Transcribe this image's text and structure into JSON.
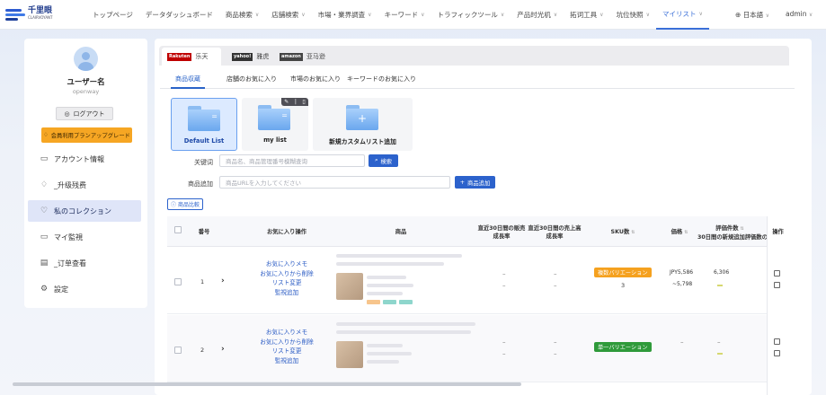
{
  "brand": {
    "name": "千里眼",
    "sub": "CLAIRVOYANT"
  },
  "nav": [
    {
      "label": "トップページ",
      "dropdown": false
    },
    {
      "label": "データダッシュボード",
      "dropdown": false
    },
    {
      "label": "商品検索",
      "dropdown": true
    },
    {
      "label": "店舗検索",
      "dropdown": true
    },
    {
      "label": "市場・業界調査",
      "dropdown": true
    },
    {
      "label": "キーワード",
      "dropdown": true
    },
    {
      "label": "トラフィックツール",
      "dropdown": true
    },
    {
      "label": "产品时光机",
      "dropdown": true
    },
    {
      "label": "拓词工具",
      "dropdown": true
    },
    {
      "label": "坑位快照",
      "dropdown": true
    },
    {
      "label": "マイリスト",
      "dropdown": true,
      "active": true
    }
  ],
  "language": "日本語",
  "user_menu": "admin",
  "profile": {
    "name": "ユーザー名",
    "id": "openway",
    "logout": "ログアウト",
    "upgrade": "会員利用プランアップグレード"
  },
  "side_menu": [
    {
      "label": "アカウント情報",
      "icon": "id-card-icon"
    },
    {
      "label": "_升级残费",
      "icon": "diamond-icon"
    },
    {
      "label": "私のコレクション",
      "icon": "heart-icon",
      "active": true
    },
    {
      "label": "マイ監視",
      "icon": "monitor-icon"
    },
    {
      "label": "_订单查看",
      "icon": "order-icon"
    },
    {
      "label": "設定",
      "icon": "gear-icon"
    }
  ],
  "platforms": [
    {
      "logo": "Rakuten",
      "label": "乐天",
      "active": true
    },
    {
      "logo": "yahoo!",
      "label": "雅虎"
    },
    {
      "logo": "amazon",
      "label": "亚马逊"
    }
  ],
  "subtabs": [
    "商品収蔵",
    "店舗のお気に入り",
    "市場のお気に入り",
    "キーワードのお気に入り"
  ],
  "lists": [
    {
      "label": "Default List",
      "active": true
    },
    {
      "label": "my list"
    },
    {
      "label": "新規カスタムリスト追加",
      "add": true
    }
  ],
  "keyword": {
    "label": "关键词",
    "placeholder": "商品名、商品管理番号模糊查询",
    "button": "検索"
  },
  "add_product": {
    "label": "商品追加",
    "placeholder": "商品URLを入力してください",
    "button": "商品追加"
  },
  "compare_button": "商品比較",
  "table": {
    "headers": {
      "no": "番号",
      "ops": "お気に入り操作",
      "product": "商品",
      "growth30": [
        "直近30日間の販売",
        "成長率"
      ],
      "sales30": [
        "直近30日間の売上高",
        "成長率"
      ],
      "sku": "SKU数",
      "price": "価格",
      "reviews": [
        "評価件数",
        "30日間の新規追加評価数の"
      ],
      "action": "操作"
    },
    "ops_links": [
      "お気に入りメモ",
      "お気に入りから削除",
      "リスト変更",
      "監視追加"
    ],
    "rows": [
      {
        "no": "1",
        "growth": [
          "–",
          "–"
        ],
        "sales": [
          "–",
          "–"
        ],
        "sku_badge": "複数バリエーション",
        "sku_color": "#f5a11f",
        "sku_count": "3",
        "price": "JPY5,586",
        "price_low": "~5,798",
        "reviews": "6,306"
      },
      {
        "no": "2",
        "growth": [
          "–",
          "–"
        ],
        "sales": [
          "–",
          "–"
        ],
        "sku_badge": "単一バリエーション",
        "sku_color": "#2f9a3a",
        "sku_count": "",
        "price": "–",
        "price_low": "",
        "reviews": "–"
      }
    ]
  }
}
